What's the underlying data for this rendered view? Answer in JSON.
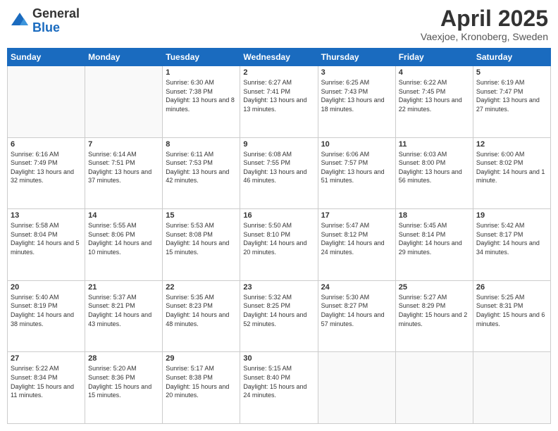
{
  "header": {
    "logo_general": "General",
    "logo_blue": "Blue",
    "month_year": "April 2025",
    "location": "Vaexjoe, Kronoberg, Sweden"
  },
  "days_of_week": [
    "Sunday",
    "Monday",
    "Tuesday",
    "Wednesday",
    "Thursday",
    "Friday",
    "Saturday"
  ],
  "weeks": [
    [
      {
        "day": "",
        "info": ""
      },
      {
        "day": "",
        "info": ""
      },
      {
        "day": "1",
        "info": "Sunrise: 6:30 AM\nSunset: 7:38 PM\nDaylight: 13 hours and 8 minutes."
      },
      {
        "day": "2",
        "info": "Sunrise: 6:27 AM\nSunset: 7:41 PM\nDaylight: 13 hours and 13 minutes."
      },
      {
        "day": "3",
        "info": "Sunrise: 6:25 AM\nSunset: 7:43 PM\nDaylight: 13 hours and 18 minutes."
      },
      {
        "day": "4",
        "info": "Sunrise: 6:22 AM\nSunset: 7:45 PM\nDaylight: 13 hours and 22 minutes."
      },
      {
        "day": "5",
        "info": "Sunrise: 6:19 AM\nSunset: 7:47 PM\nDaylight: 13 hours and 27 minutes."
      }
    ],
    [
      {
        "day": "6",
        "info": "Sunrise: 6:16 AM\nSunset: 7:49 PM\nDaylight: 13 hours and 32 minutes."
      },
      {
        "day": "7",
        "info": "Sunrise: 6:14 AM\nSunset: 7:51 PM\nDaylight: 13 hours and 37 minutes."
      },
      {
        "day": "8",
        "info": "Sunrise: 6:11 AM\nSunset: 7:53 PM\nDaylight: 13 hours and 42 minutes."
      },
      {
        "day": "9",
        "info": "Sunrise: 6:08 AM\nSunset: 7:55 PM\nDaylight: 13 hours and 46 minutes."
      },
      {
        "day": "10",
        "info": "Sunrise: 6:06 AM\nSunset: 7:57 PM\nDaylight: 13 hours and 51 minutes."
      },
      {
        "day": "11",
        "info": "Sunrise: 6:03 AM\nSunset: 8:00 PM\nDaylight: 13 hours and 56 minutes."
      },
      {
        "day": "12",
        "info": "Sunrise: 6:00 AM\nSunset: 8:02 PM\nDaylight: 14 hours and 1 minute."
      }
    ],
    [
      {
        "day": "13",
        "info": "Sunrise: 5:58 AM\nSunset: 8:04 PM\nDaylight: 14 hours and 5 minutes."
      },
      {
        "day": "14",
        "info": "Sunrise: 5:55 AM\nSunset: 8:06 PM\nDaylight: 14 hours and 10 minutes."
      },
      {
        "day": "15",
        "info": "Sunrise: 5:53 AM\nSunset: 8:08 PM\nDaylight: 14 hours and 15 minutes."
      },
      {
        "day": "16",
        "info": "Sunrise: 5:50 AM\nSunset: 8:10 PM\nDaylight: 14 hours and 20 minutes."
      },
      {
        "day": "17",
        "info": "Sunrise: 5:47 AM\nSunset: 8:12 PM\nDaylight: 14 hours and 24 minutes."
      },
      {
        "day": "18",
        "info": "Sunrise: 5:45 AM\nSunset: 8:14 PM\nDaylight: 14 hours and 29 minutes."
      },
      {
        "day": "19",
        "info": "Sunrise: 5:42 AM\nSunset: 8:17 PM\nDaylight: 14 hours and 34 minutes."
      }
    ],
    [
      {
        "day": "20",
        "info": "Sunrise: 5:40 AM\nSunset: 8:19 PM\nDaylight: 14 hours and 38 minutes."
      },
      {
        "day": "21",
        "info": "Sunrise: 5:37 AM\nSunset: 8:21 PM\nDaylight: 14 hours and 43 minutes."
      },
      {
        "day": "22",
        "info": "Sunrise: 5:35 AM\nSunset: 8:23 PM\nDaylight: 14 hours and 48 minutes."
      },
      {
        "day": "23",
        "info": "Sunrise: 5:32 AM\nSunset: 8:25 PM\nDaylight: 14 hours and 52 minutes."
      },
      {
        "day": "24",
        "info": "Sunrise: 5:30 AM\nSunset: 8:27 PM\nDaylight: 14 hours and 57 minutes."
      },
      {
        "day": "25",
        "info": "Sunrise: 5:27 AM\nSunset: 8:29 PM\nDaylight: 15 hours and 2 minutes."
      },
      {
        "day": "26",
        "info": "Sunrise: 5:25 AM\nSunset: 8:31 PM\nDaylight: 15 hours and 6 minutes."
      }
    ],
    [
      {
        "day": "27",
        "info": "Sunrise: 5:22 AM\nSunset: 8:34 PM\nDaylight: 15 hours and 11 minutes."
      },
      {
        "day": "28",
        "info": "Sunrise: 5:20 AM\nSunset: 8:36 PM\nDaylight: 15 hours and 15 minutes."
      },
      {
        "day": "29",
        "info": "Sunrise: 5:17 AM\nSunset: 8:38 PM\nDaylight: 15 hours and 20 minutes."
      },
      {
        "day": "30",
        "info": "Sunrise: 5:15 AM\nSunset: 8:40 PM\nDaylight: 15 hours and 24 minutes."
      },
      {
        "day": "",
        "info": ""
      },
      {
        "day": "",
        "info": ""
      },
      {
        "day": "",
        "info": ""
      }
    ]
  ]
}
